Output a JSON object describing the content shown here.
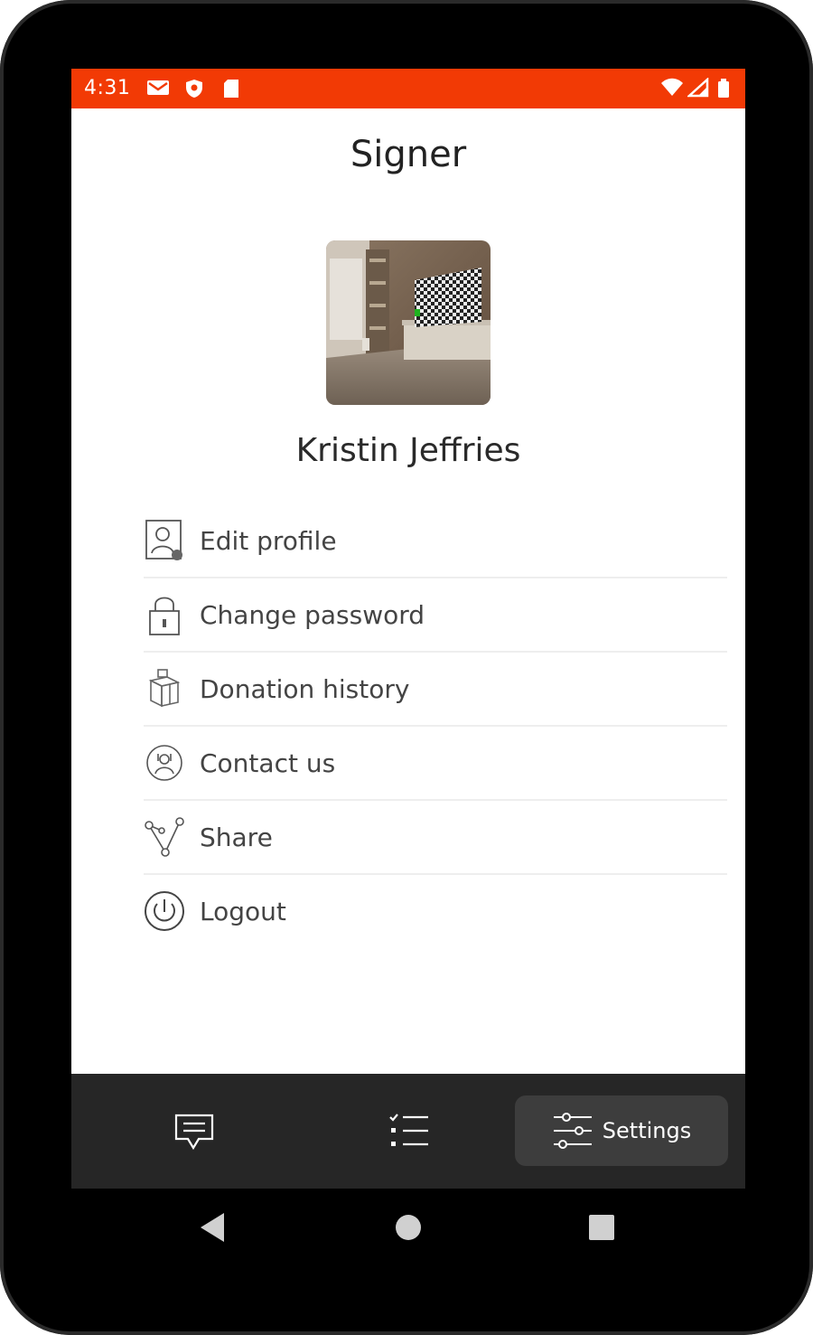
{
  "status_bar": {
    "time": "4:31",
    "left_icons": [
      "gmail-icon",
      "shield-icon",
      "sd-card-icon"
    ],
    "right_icons": [
      "wifi-icon",
      "signal-icon",
      "battery-icon"
    ],
    "color": "#f23a05"
  },
  "header": {
    "title": "Signer"
  },
  "profile": {
    "name": "Kristin Jeffries",
    "avatar": "room-photo"
  },
  "menu": {
    "items": [
      {
        "label": "Edit profile",
        "icon": "user-edit-icon"
      },
      {
        "label": "Change password",
        "icon": "lock-icon"
      },
      {
        "label": "Donation history",
        "icon": "gift-box-icon"
      },
      {
        "label": "Contact us",
        "icon": "contact-support-icon"
      },
      {
        "label": "Share",
        "icon": "share-icon"
      },
      {
        "label": "Logout",
        "icon": "power-icon"
      }
    ]
  },
  "bottom_nav": {
    "tabs": [
      {
        "name": "messages",
        "icon": "message-icon",
        "label": ""
      },
      {
        "name": "list",
        "icon": "checklist-icon",
        "label": ""
      },
      {
        "name": "settings",
        "icon": "sliders-icon",
        "label": "Settings",
        "active": true
      }
    ],
    "background": "#262626"
  },
  "system_nav": [
    "back-icon",
    "home-icon",
    "recents-icon"
  ]
}
